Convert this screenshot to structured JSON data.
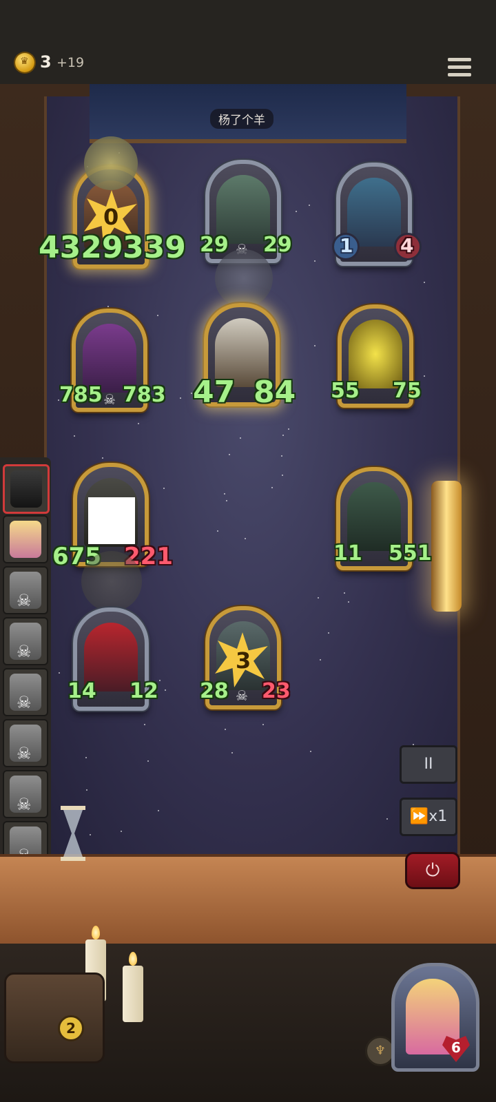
{
  "top_bar": {
    "gold": "3",
    "gold_income": "+19",
    "icons": [
      "coin-icon",
      "menu-icon"
    ]
  },
  "opponent": {
    "name": "杨了个羊"
  },
  "board": {
    "cards": [
      {
        "id": "c1",
        "attack": "4329",
        "health": "339",
        "star_level": "0",
        "frame": "gold"
      },
      {
        "id": "c2",
        "attack": "29",
        "health": "29",
        "frame": "silver"
      },
      {
        "id": "c3",
        "attack": "1",
        "health": "4",
        "frame": "silver"
      },
      {
        "id": "c4",
        "attack": "785",
        "health": "783",
        "frame": "gold"
      },
      {
        "id": "c5",
        "attack": "47",
        "health": "84",
        "frame": "gold"
      },
      {
        "id": "c6",
        "attack": "55",
        "health": "75",
        "frame": "gold"
      },
      {
        "id": "c7",
        "attack": "675",
        "health": "221",
        "frame": "gold"
      },
      {
        "id": "c8",
        "attack": "11",
        "health": "551",
        "frame": "gold"
      },
      {
        "id": "c9",
        "attack": "14",
        "health": "12",
        "frame": "silver"
      },
      {
        "id": "c10",
        "attack": "28",
        "health": "23",
        "star_level": "3",
        "frame": "gold"
      }
    ]
  },
  "sidebar": {
    "players": 8,
    "active_index": 0
  },
  "controls": {
    "pause_label": "II",
    "speed_label": "x1",
    "power_icon": "power-icon"
  },
  "bottom": {
    "chest_count": "2",
    "hero_health": "6"
  }
}
